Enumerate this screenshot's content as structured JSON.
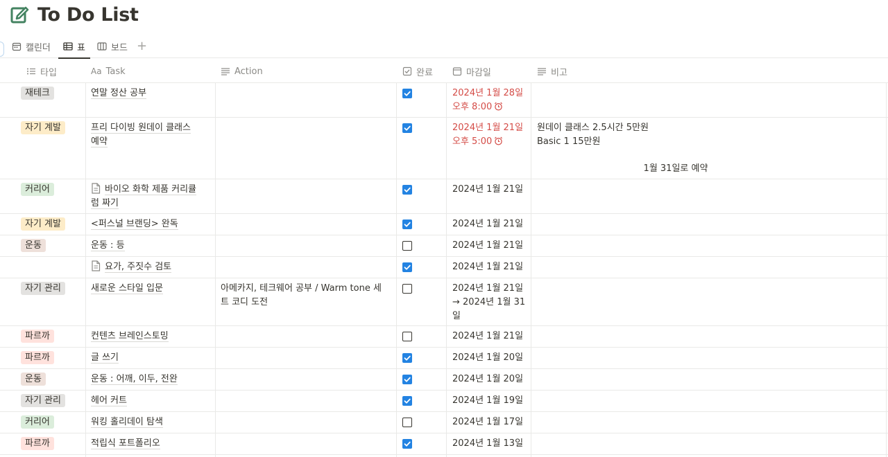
{
  "page": {
    "title": "To Do List"
  },
  "tabs": [
    {
      "label": "캘린더",
      "icon": "calendar-icon"
    },
    {
      "label": "표",
      "icon": "table-icon"
    },
    {
      "label": "보드",
      "icon": "board-icon"
    }
  ],
  "tab_add_label": "+",
  "columns": {
    "type": "타입",
    "task_prefix": "Aa",
    "task": "Task",
    "action": "Action",
    "done": "완료",
    "due": "마감일",
    "note": "비고"
  },
  "colors": {
    "accent": "#2383e2",
    "overdue": "#d44c47",
    "tag_yellow": "#fdecc8",
    "tag_red": "#ffe2dd",
    "tag_green": "#dbeddb",
    "tag_gray": "#e3e2e0",
    "tag_brown": "#eee0da"
  },
  "rows": [
    {
      "type": "재테크",
      "tag_color": "#e3e2e0",
      "task": "연말 정산 공부",
      "doc": false,
      "action": "",
      "done": true,
      "due": "2024년 1월 28일",
      "due2": "오후 8:00",
      "overdue": true,
      "note": "",
      "note2": "",
      "note3": ""
    },
    {
      "type": "자기 계발",
      "tag_color": "#fdecc8",
      "task": "프리 다이빙 원데이 클래스",
      "task2": "예약",
      "doc": false,
      "action": "",
      "done": true,
      "due": "2024년 1월 21일",
      "due2": "오후 5:00",
      "overdue": true,
      "note": "원데이 클래스 2.5시간 5만원",
      "note2": "Basic 1 15만원",
      "note3": "1월 31일로 예약"
    },
    {
      "type": "커리어",
      "tag_color": "#dbeddb",
      "task": "바이오 화학 제품 커리큘",
      "task2": "럼 짜기",
      "doc": true,
      "action": "",
      "done": true,
      "due": "2024년 1월 21일",
      "due2": "",
      "overdue": false,
      "note": "",
      "note2": "",
      "note3": ""
    },
    {
      "type": "자기 계발",
      "tag_color": "#fdecc8",
      "task": "<퍼스널 브랜딩> 완독",
      "doc": false,
      "action": "",
      "done": true,
      "due": "2024년 1월 21일",
      "due2": "",
      "overdue": false,
      "note": "",
      "note2": "",
      "note3": ""
    },
    {
      "type": "운동",
      "tag_color": "#eee0da",
      "task": "운동 : 등",
      "doc": false,
      "action": "",
      "done": false,
      "due": "2024년 1월 21일",
      "due2": "",
      "overdue": false,
      "note": "",
      "note2": "",
      "note3": ""
    },
    {
      "type": "",
      "tag_color": "",
      "task": "요가, 주짓수 검토",
      "doc": true,
      "action": "",
      "done": true,
      "due": "2024년 1월 21일",
      "due2": "",
      "overdue": false,
      "note": "",
      "note2": "",
      "note3": ""
    },
    {
      "type": "자기 관리",
      "tag_color": "#e3e2e0",
      "task": "새로운 스타일 입문",
      "doc": false,
      "action": "아메카지, 테크웨어 공부 / Warm tone 세",
      "action2": "트 코디 도전",
      "done": false,
      "due": "2024년 1월 21일",
      "due2": "→ 2024년 1월 31",
      "due3": "일",
      "overdue": false,
      "note": "",
      "note2": "",
      "note3": ""
    },
    {
      "type": "파르까",
      "tag_color": "#ffe2dd",
      "task": "컨텐츠 브레인스토밍",
      "doc": false,
      "action": "",
      "done": false,
      "due": "2024년 1월 21일",
      "due2": "",
      "overdue": false,
      "note": "",
      "note2": "",
      "note3": ""
    },
    {
      "type": "파르까",
      "tag_color": "#ffe2dd",
      "task": "글 쓰기",
      "doc": false,
      "action": "",
      "done": true,
      "due": "2024년 1월 20일",
      "due2": "",
      "overdue": false,
      "note": "",
      "note2": "",
      "note3": ""
    },
    {
      "type": "운동",
      "tag_color": "#eee0da",
      "task": "운동 : 어깨, 이두, 전완",
      "doc": false,
      "action": "",
      "done": true,
      "due": "2024년 1월 20일",
      "due2": "",
      "overdue": false,
      "note": "",
      "note2": "",
      "note3": ""
    },
    {
      "type": "자기 관리",
      "tag_color": "#e3e2e0",
      "task": "헤어 커트",
      "doc": false,
      "action": "",
      "done": true,
      "due": "2024년 1월 19일",
      "due2": "",
      "overdue": false,
      "note": "",
      "note2": "",
      "note3": ""
    },
    {
      "type": "커리어",
      "tag_color": "#dbeddb",
      "task": "워킹 홀리데이 탐색",
      "doc": false,
      "action": "",
      "done": false,
      "due": "2024년 1월 17일",
      "due2": "",
      "overdue": false,
      "note": "",
      "note2": "",
      "note3": ""
    },
    {
      "type": "파르까",
      "tag_color": "#ffe2dd",
      "task": "적립식 포트폴리오",
      "doc": false,
      "action": "",
      "done": true,
      "due": "2024년 1월 13일",
      "due2": "",
      "overdue": false,
      "note": "",
      "note2": "",
      "note3": ""
    }
  ]
}
